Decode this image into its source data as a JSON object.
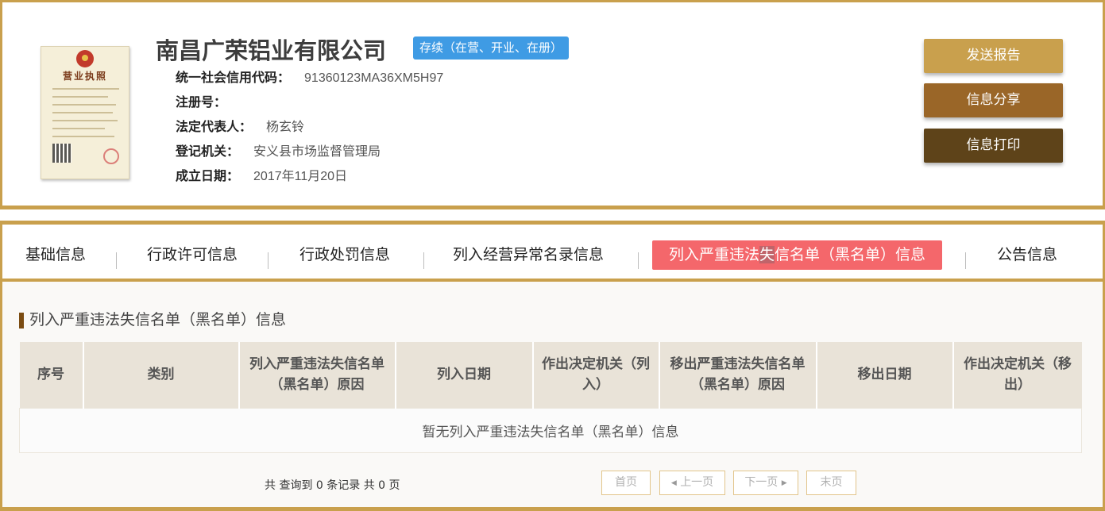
{
  "company": {
    "name": "南昌广荣铝业有限公司",
    "status": "存续（在营、开业、在册）",
    "fields": [
      {
        "label": "统一社会信用代码：",
        "value": "91360123MA36XM5H97"
      },
      {
        "label": "注册号：",
        "value": ""
      },
      {
        "label": "法定代表人：",
        "value": "杨玄铃"
      },
      {
        "label": "登记机关：",
        "value": "安义县市场监督管理局"
      },
      {
        "label": "成立日期：",
        "value": "2017年11月20日"
      }
    ],
    "license": {
      "title": "营业执照"
    }
  },
  "actions": {
    "send_report": "发送报告",
    "share": "信息分享",
    "print": "信息打印"
  },
  "colors": {
    "gold": "#c9a04d",
    "brown": "#9a6628",
    "dark_brown": "#5e4319",
    "status_blue": "#3f9be4",
    "active_tab": "#f4676b"
  },
  "tabs": [
    {
      "label": "基础信息"
    },
    {
      "label": "行政许可信息"
    },
    {
      "label": "行政处罚信息"
    },
    {
      "label": "列入经营异常名录信息"
    },
    {
      "label_a": "列入严重违法",
      "label_b": "失",
      "label_c": "信名单（黑名单）信息",
      "active": true
    },
    {
      "label": "公告信息"
    }
  ],
  "section": {
    "title": "列入严重违法失信名单（黑名单）信息",
    "columns": [
      "序号",
      "类别",
      "列入严重违法失信名单（黑名单）原因",
      "列入日期",
      "作出决定机关（列入）",
      "移出严重违法失信名单（黑名单）原因",
      "移出日期",
      "作出决定机关（移出）"
    ],
    "empty_text": "暂无列入严重违法失信名单（黑名单）信息"
  },
  "pagination": {
    "summary": "共 查询到 0 条记录 共 0 页",
    "first": "首页",
    "prev": "上一页",
    "next": "下一页",
    "last": "末页"
  }
}
